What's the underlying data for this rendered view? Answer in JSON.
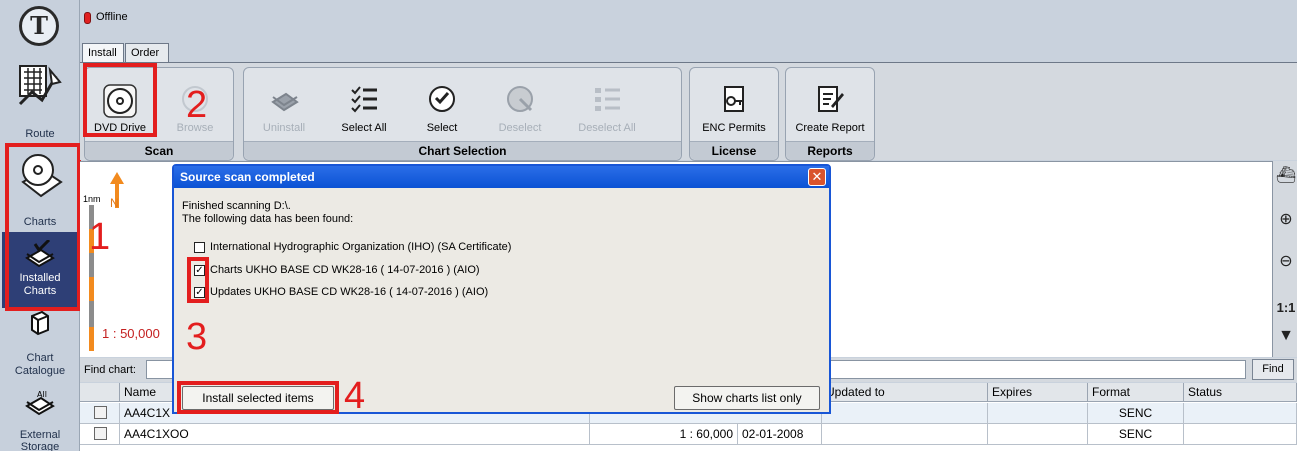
{
  "status": {
    "text": "Offline",
    "color": "#e02020"
  },
  "tabs": [
    {
      "label": "Install",
      "active": true
    },
    {
      "label": "Order",
      "active": false
    }
  ],
  "sidebar": {
    "logo": "T",
    "items": [
      {
        "label": "Route",
        "icon": "route-icon"
      },
      {
        "label": "Charts",
        "icon": "charts-disc-icon"
      },
      {
        "label": "Installed Charts",
        "icon": "installed-charts-icon",
        "active": true
      },
      {
        "label": "Chart Catalogue",
        "icon": "catalogue-icon"
      },
      {
        "label": "External Storage",
        "icon": "external-storage-icon"
      }
    ]
  },
  "ribbon": {
    "groups": [
      {
        "title": "Scan",
        "buttons": [
          {
            "label": "DVD Drive",
            "icon": "dvd-icon",
            "enabled": true
          },
          {
            "label": "Browse",
            "icon": "browse-icon",
            "enabled": false
          }
        ]
      },
      {
        "title": "Chart Selection",
        "buttons": [
          {
            "label": "Uninstall",
            "icon": "uninstall-icon",
            "enabled": false
          },
          {
            "label": "Select All",
            "icon": "select-all-icon",
            "enabled": true
          },
          {
            "label": "Select",
            "icon": "select-icon",
            "enabled": true
          },
          {
            "label": "Deselect",
            "icon": "deselect-icon",
            "enabled": false
          },
          {
            "label": "Deselect All",
            "icon": "deselect-all-icon",
            "enabled": false
          }
        ]
      },
      {
        "title": "License",
        "buttons": [
          {
            "label": "ENC Permits",
            "icon": "key-icon",
            "enabled": true
          }
        ]
      },
      {
        "title": "Reports",
        "buttons": [
          {
            "label": "Create Report",
            "icon": "report-icon",
            "enabled": true
          }
        ]
      }
    ]
  },
  "map": {
    "scale_bar_label": "1nm",
    "scale_text": "1 : 50,000",
    "north_label": "N"
  },
  "map_tools": [
    "ship-icon",
    "zoom-in-icon",
    "zoom-out-icon",
    "1:1",
    "down-arrow-icon"
  ],
  "find": {
    "label": "Find chart:",
    "value": "",
    "button": "Find"
  },
  "table": {
    "columns": [
      "Name",
      "Updated to",
      "Expires",
      "Format",
      "Status"
    ],
    "rows": [
      {
        "name": "AA4C1X",
        "scale": "",
        "date": "",
        "updated_to": "",
        "expires": "",
        "format": "SENC",
        "status": ""
      },
      {
        "name": "AA4C1XOO",
        "scale": "1 : 60,000",
        "date": "02-01-2008",
        "updated_to": "",
        "expires": "",
        "format": "SENC",
        "status": ""
      }
    ]
  },
  "dialog": {
    "title": "Source scan completed",
    "line1": "Finished scanning D:\\.",
    "line2": "The following data has been found:",
    "items": [
      {
        "label": "International Hydrographic Organization (IHO) (SA Certificate)",
        "checked": false
      },
      {
        "label": "Charts UKHO BASE CD WK28-16    ( 14-07-2016 ) (AIO)",
        "checked": true
      },
      {
        "label": "Updates UKHO BASE CD WK28-16    ( 14-07-2016 ) (AIO)",
        "checked": true
      }
    ],
    "install_button": "Install selected items",
    "show_button": "Show charts list only"
  },
  "annotations": [
    "1",
    "2",
    "3",
    "4"
  ],
  "colors": {
    "highlight": "#e31e1e",
    "sidebar_active": "#2e3f76",
    "dialog_title": "#0b52d4"
  }
}
